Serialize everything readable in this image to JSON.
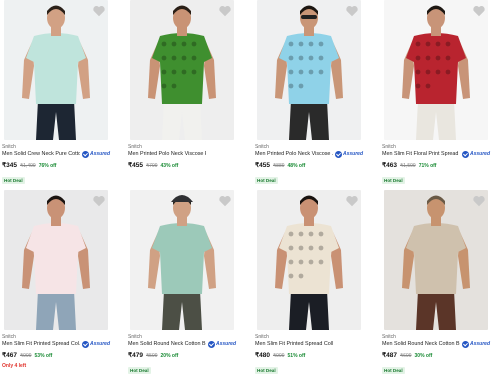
{
  "products": [
    {
      "brand": "Snitch",
      "name": "Men Solid Crew Neck Pure Cotto...",
      "assured": "Assured",
      "price": "₹345",
      "mrp": "₹1,499",
      "off": "76% off",
      "tag": "Hot Deal",
      "stock": "",
      "colors": {
        "bg": "#eef1f2",
        "shirt": "#bfe4dc",
        "pants": "#1d2633",
        "skin": "#d2a184",
        "hair": "#2b2119"
      }
    },
    {
      "brand": "Snitch",
      "name": "Men Printed Polo Neck Viscose Rayon Green ...",
      "assured": "",
      "price": "₹455",
      "mrp": "₹799",
      "off": "43% off",
      "tag": "",
      "stock": "",
      "colors": {
        "bg": "#eeeeee",
        "shirt": "#3f8f2f",
        "pants": "#f1f1ee",
        "skin": "#c99375",
        "hair": "#2a1f17"
      }
    },
    {
      "brand": "Snitch",
      "name": "Men Printed Polo Neck Viscose ...",
      "assured": "Assured",
      "price": "₹455",
      "mrp": "₹889",
      "off": "48% off",
      "tag": "Hot Deal",
      "stock": "",
      "colors": {
        "bg": "#eff0f1",
        "shirt": "#8fd2e8",
        "pants": "#2a2a2a",
        "skin": "#c99677",
        "hair": "#1d1712"
      }
    },
    {
      "brand": "Snitch",
      "name": "Men Slim Fit Floral Print Spread ...",
      "assured": "Assured",
      "price": "₹463",
      "mrp": "₹1,599",
      "off": "71% off",
      "tag": "Hot Deal",
      "stock": "",
      "colors": {
        "bg": "#f6f6f6",
        "shirt": "#b9242f",
        "pants": "#e9e6df",
        "skin": "#c89478",
        "hair": "#1e1813"
      }
    },
    {
      "brand": "Snitch",
      "name": "Men Slim Fit Printed Spread Col...",
      "assured": "Assured",
      "price": "₹467",
      "mrp": "₹999",
      "off": "53% off",
      "tag": "",
      "stock": "Only 4 left",
      "colors": {
        "bg": "#e9e9ea",
        "shirt": "#f6e4e6",
        "pants": "#8fa5b8",
        "skin": "#c99276",
        "hair": "#1c1512"
      }
    },
    {
      "brand": "Snitch",
      "name": "Men Solid Round Neck Cotton Bl...",
      "assured": "Assured",
      "price": "₹479",
      "mrp": "₹599",
      "off": "20% off",
      "tag": "Hot Deal",
      "stock": "",
      "colors": {
        "bg": "#f1f1f1",
        "shirt": "#9cc9b9",
        "pants": "#4c4f45",
        "skin": "#d0a184",
        "hair": "#2a2620"
      }
    },
    {
      "brand": "Snitch",
      "name": "Men Slim Fit Printed Spread Collar Casual Shirt",
      "assured": "",
      "price": "₹480",
      "mrp": "₹999",
      "off": "51% off",
      "tag": "Hot Deal",
      "stock": "",
      "colors": {
        "bg": "#eeeeee",
        "shirt": "#ece3d3",
        "pants": "#1b1e25",
        "skin": "#c99174",
        "hair": "#18120f"
      }
    },
    {
      "brand": "Snitch",
      "name": "Men Solid Round Neck Cotton Bl...",
      "assured": "Assured",
      "price": "₹487",
      "mrp": "₹699",
      "off": "30% off",
      "tag": "Hot Deal",
      "stock": "",
      "colors": {
        "bg": "#e4e1dd",
        "shirt": "#cfc1ad",
        "pants": "#5b3528",
        "skin": "#c7936f",
        "hair": "#6a5a46"
      }
    }
  ]
}
